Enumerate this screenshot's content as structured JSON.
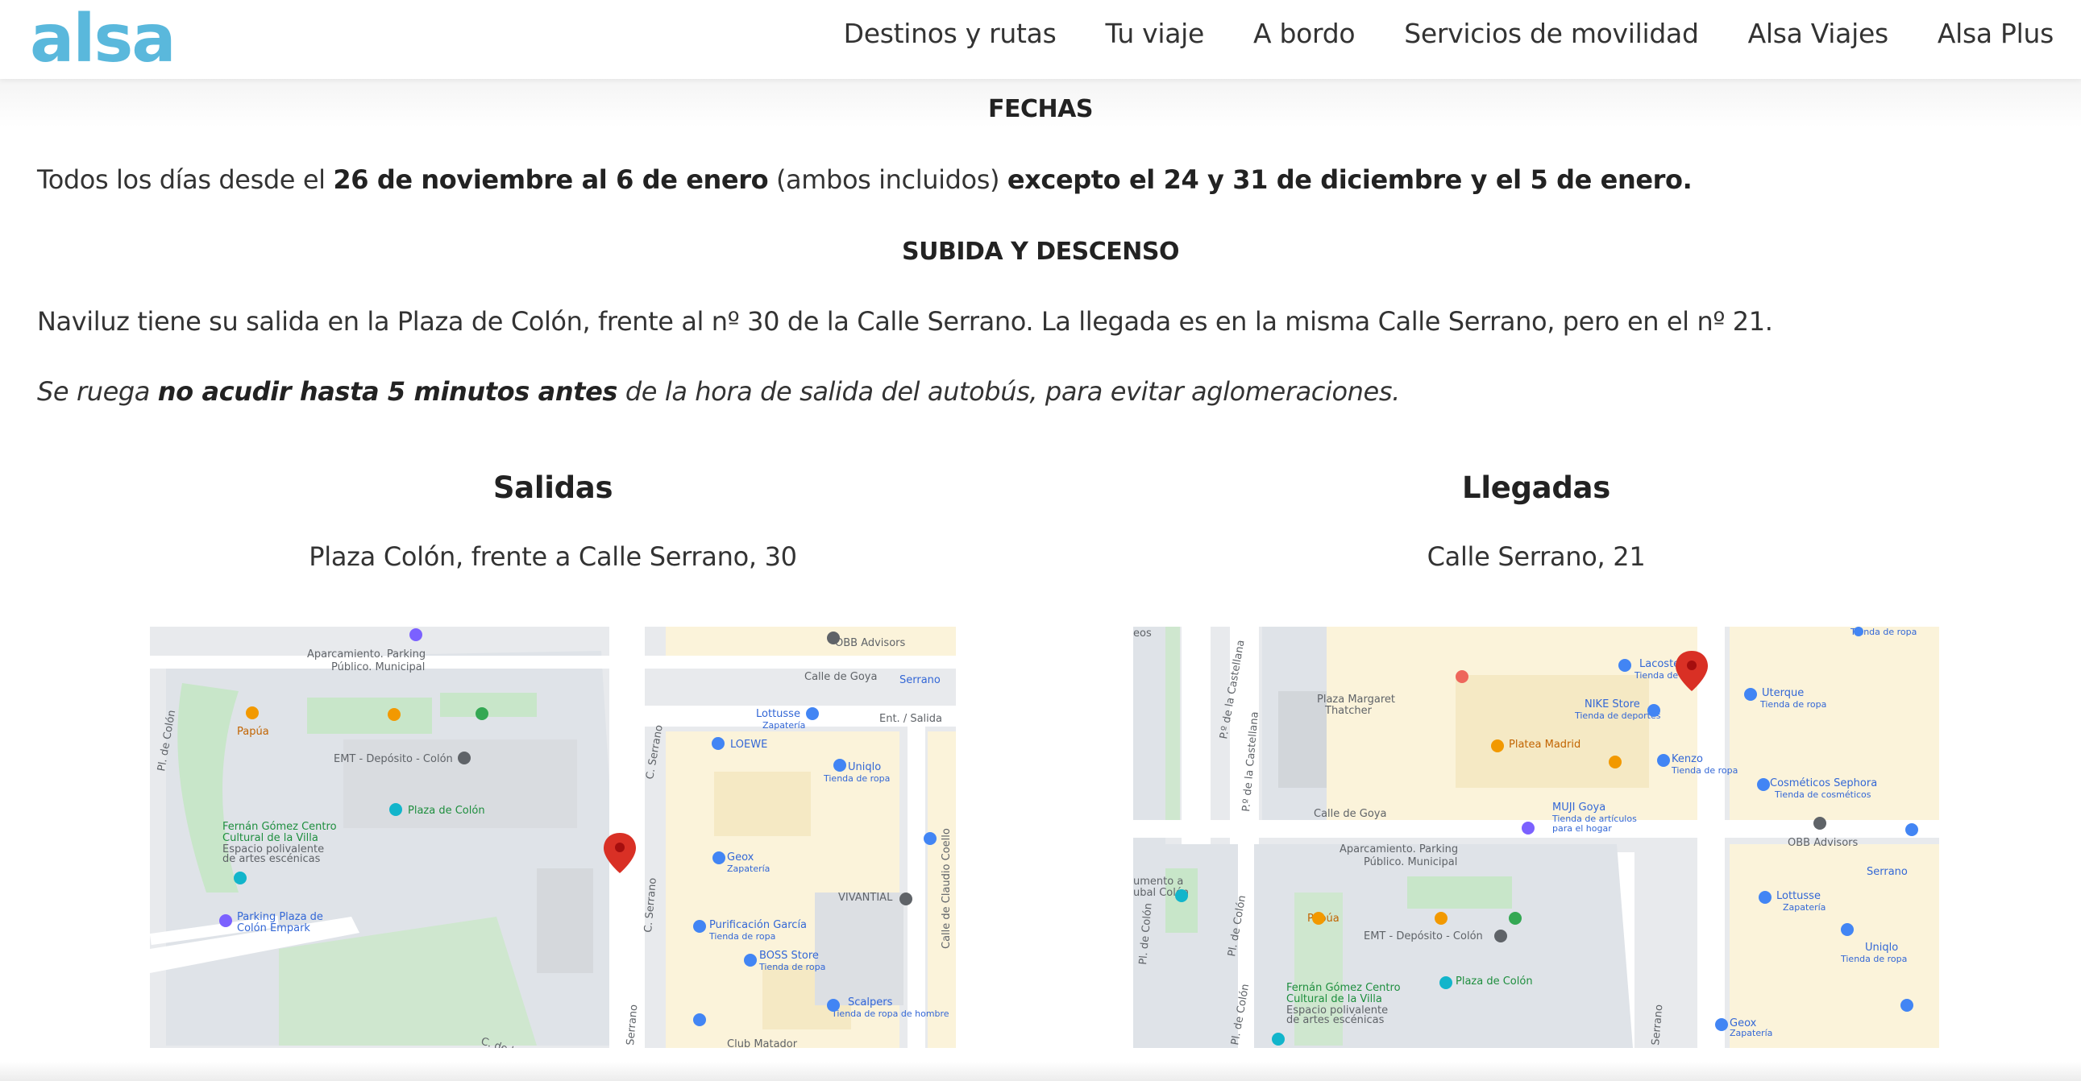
{
  "header": {
    "logo_text": "alsa",
    "nav": [
      "Destinos y rutas",
      "Tu viaje",
      "A bordo",
      "Servicios de movilidad",
      "Alsa Viajes",
      "Alsa Plus"
    ]
  },
  "colors": {
    "brand": "#5ab8dc",
    "text": "#333333"
  },
  "fechas": {
    "heading": "FECHAS",
    "text_1": "Todos los días desde el ",
    "bold_1": "26 de noviembre al 6 de enero",
    "text_2": " (ambos incluidos) ",
    "bold_2": "excepto el 24 y 31 de diciembre y el 5 de enero."
  },
  "subida": {
    "heading": "SUBIDA Y DESCENSO",
    "paragraph": "Naviluz tiene su salida en la Plaza de Colón, frente al nº 30 de la Calle Serrano. La llegada es en la misma Calle Serrano, pero en el nº 21.",
    "note_1": "Se ruega ",
    "note_bold": "no acudir hasta 5 minutos antes",
    "note_2": " de la hora de salida del autobús, para evitar aglomeraciones."
  },
  "salidas": {
    "title": "Salidas",
    "address": "Plaza Colón, frente a Calle Serrano, 30",
    "map_labels": {
      "parking": "Aparcamiento. Parking",
      "parking2": "Público. Municipal",
      "obb": "OBB Advisors",
      "goya": "Calle de Goya",
      "serrano_metro": "Serrano",
      "lottusse": "Lottusse",
      "zapateria": "Zapatería",
      "ent_salida": "Ent. / Salida",
      "loewe": "LOEWE",
      "uniqlo": "Uniqlo",
      "tienda_ropa": "Tienda de ropa",
      "papua": "Papúa",
      "emt": "EMT - Depósito - Colón",
      "plaza_colon": "Plaza de Colón",
      "fernan": "Fernán Gómez Centro",
      "fernan2": "Cultural de la Villa",
      "fernan3": "Espacio polivalente",
      "fernan4": "de artes escénicas",
      "parking_plaza": "Parking Plaza de",
      "parking_plaza2": "Colón Empark",
      "geox": "Geox",
      "vivantial": "VIVANTIAL",
      "purificacion": "Purificación García",
      "boss": "BOSS Store",
      "scalpers": "Scalpers",
      "tienda_hombre": "Tienda de ropa de hombre",
      "club_matador": "Club Matador",
      "c_serrano": "C. Serrano",
      "serrano": "Serrano",
      "pl_colon": "Pl. de Colón",
      "claudio_coello": "Calle de Claudio Coello",
      "c_de_la": "C. de la V..."
    }
  },
  "llegadas": {
    "title": "Llegadas",
    "address": "Calle Serrano, 21",
    "map_labels": {
      "lacoste": "Lacoste",
      "tienda_ropa": "Tienda de ropa",
      "nike": "NIKE Store",
      "tienda_deportes": "Tienda de deportes",
      "uterque": "Uterque",
      "plaza_margaret": "Plaza Margaret",
      "thatcher": "Thatcher",
      "platea": "Platea Madrid",
      "kenzo": "Kenzo",
      "muji": "MUJI Goya",
      "muji2": "Tienda de artículos",
      "muji3": "para el hogar",
      "sephora": "Cosméticos Sephora",
      "sephora2": "Tienda de cosméticos",
      "obb": "OBB Advisors",
      "goya": "Calle de Goya",
      "parking": "Aparcamiento. Parking",
      "parking2": "Público. Municipal",
      "serrano_metro": "Serrano",
      "lottusse": "Lottusse",
      "zapateria": "Zapatería",
      "uniqlo": "Uniqlo",
      "papua": "Papúa",
      "emt": "EMT - Depósito - Colón",
      "plaza_colon": "Plaza de Colón",
      "fernan": "Fernán Gómez Centro",
      "fernan2": "Cultural de la Villa",
      "fernan3": "Espacio polivalente",
      "fernan4": "de artes escénicas",
      "monumento": "umento a",
      "monumento2": "ubal Colón",
      "geox": "Geox",
      "castellana": "P.º de la Castellana",
      "serrano": "Serrano",
      "pl_colon": "Pl. de Colón",
      "eos": "eos"
    }
  }
}
